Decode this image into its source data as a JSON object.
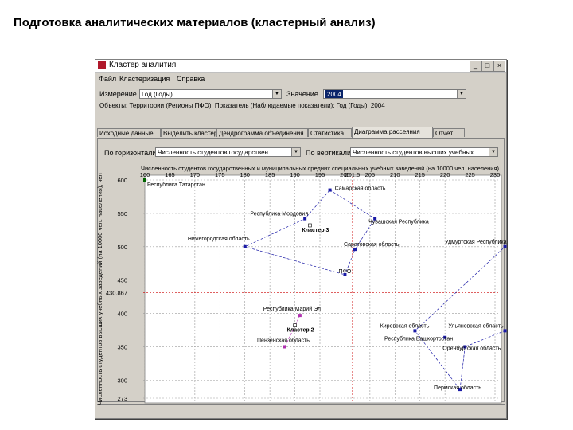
{
  "slide_title": "Подготовка аналитических материалов (кластерный анализ)",
  "window": {
    "title": "Кластер аналития",
    "buttons": [
      "_",
      "□",
      "×"
    ]
  },
  "menu": [
    "Файл",
    "Кластеризация",
    "Справка"
  ],
  "controls": {
    "measure_label": "Измерение",
    "measure_value": "Год (Годы)",
    "value_label": "Значение",
    "value_value": "2004",
    "objects_text": "Объекты: Территории (Регионы ПФО); Показатель (Наблюдаемые показатели); Год (Годы): 2004"
  },
  "tabs": [
    {
      "label": "Исходные данные",
      "active": false
    },
    {
      "label": "Выделить кластеры",
      "active": false
    },
    {
      "label": "Дендрограмма объединения",
      "active": false
    },
    {
      "label": "Статистика",
      "active": false
    },
    {
      "label": "Диаграмма рассеяния",
      "active": true
    },
    {
      "label": "Отчёт",
      "active": false
    }
  ],
  "axes_selectors": {
    "x_label": "По горизонтали",
    "x_value": "Численность студентов государствен",
    "y_label": "По вертикали",
    "y_value": "Численность студентов высших учебных"
  },
  "chart_data": {
    "type": "scatter",
    "title": "Численность студентов государственных и муниципальных средних специальных учебных заведений (на 10000 чел. населения)",
    "ylabel": "Численность студентов высших учебных заведений (на 10000 чел. населения), чел",
    "x_ticks": [
      "160",
      "165",
      "170",
      "175",
      "180",
      "185",
      "190",
      "195",
      "200",
      "205",
      "210",
      "215",
      "220",
      "225",
      "230"
    ],
    "x_highlight": {
      "value": 201.5,
      "label": "201.5"
    },
    "y_ticks": [
      "600",
      "550",
      "500",
      "450",
      "400",
      "350",
      "300",
      "273"
    ],
    "y_highlight": {
      "value": 430.867,
      "label": "430.867"
    },
    "xlim": [
      160,
      230
    ],
    "ylim": [
      273,
      600
    ],
    "points": [
      {
        "name": "Республика Татарстан",
        "x": 160,
        "y": 600,
        "color": "#006400"
      },
      {
        "name": "Самарская область",
        "x": 197,
        "y": 585,
        "color": "#1a1aa6"
      },
      {
        "name": "Республика Мордовия",
        "x": 192,
        "y": 542,
        "color": "#1a1aa6"
      },
      {
        "name": "Чувашская Республика",
        "x": 206,
        "y": 542,
        "color": "#1a1aa6"
      },
      {
        "name": "Нижегородская область",
        "x": 180,
        "y": 500,
        "color": "#1a1aa6"
      },
      {
        "name": "Саратовская область",
        "x": 202,
        "y": 496,
        "color": "#1a1aa6"
      },
      {
        "name": "Удмуртская Республика",
        "x": 232,
        "y": 500,
        "color": "#1a1aa6"
      },
      {
        "name": "ПФО",
        "x": 200,
        "y": 458,
        "color": "#1a1aa6"
      },
      {
        "name": "Республика Марий Эл",
        "x": 191,
        "y": 397,
        "color": "#b030b0"
      },
      {
        "name": "Пензенская область",
        "x": 188,
        "y": 350,
        "color": "#b030b0"
      },
      {
        "name": "Кировская область",
        "x": 214,
        "y": 374,
        "color": "#1a1aa6"
      },
      {
        "name": "Ульяновская область",
        "x": 232,
        "y": 374,
        "color": "#1a1aa6"
      },
      {
        "name": "Республика Башкортостан",
        "x": 220,
        "y": 364,
        "color": "#1a1aa6"
      },
      {
        "name": "Оренбургская область",
        "x": 224,
        "y": 350,
        "color": "#1a1aa6"
      },
      {
        "name": "Пермская область",
        "x": 223,
        "y": 286,
        "color": "#1a1aa6"
      }
    ],
    "clusters": [
      {
        "name": "Кластер 3",
        "x": 193,
        "y": 532
      },
      {
        "name": "Кластер 2",
        "x": 190,
        "y": 382
      }
    ]
  }
}
